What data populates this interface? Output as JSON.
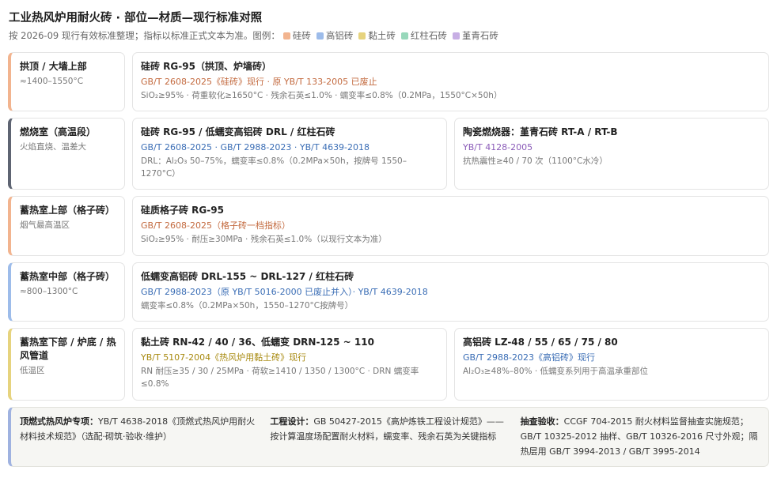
{
  "header": {
    "title": "工业热风炉用耐火砖 · 部位—材质—现行标准对照",
    "subtitle": "按 2026-09 现行有效标准整理；指标以标准正式文本为准。图例：",
    "legend": [
      {
        "label": "硅砖",
        "color": "#f2b48f"
      },
      {
        "label": "高铝砖",
        "color": "#9dbcea"
      },
      {
        "label": "黏土砖",
        "color": "#e6d37e"
      },
      {
        "label": "红柱石砖",
        "color": "#98d8bb"
      },
      {
        "label": "堇青石砖",
        "color": "#c7aee4"
      }
    ]
  },
  "rows": [
    {
      "label": {
        "title": "拱顶 / 大墙上部",
        "sub": "≈1400–1550°C",
        "accent": "#f2b48f"
      },
      "cards": [
        {
          "title": "硅砖 RG-95（拱顶、炉墙砖）",
          "std": "GB/T 2608-2025《硅砖》现行 · 原 YB/T 133-2005 已废止",
          "std_class": "silica",
          "note": "SiO₂≥95% · 荷重软化≥1650°C · 残余石英≤1.0% · 蠕变率≤0.8%（0.2MPa，1550°C×50h）"
        }
      ]
    },
    {
      "label": {
        "title": "燃烧室（高温段）",
        "sub": "火焰直烧、温差大",
        "accent": "#5e6472"
      },
      "cards": [
        {
          "title": "硅砖 RG-95 / 低蠕变高铝砖 DRL / 红柱石砖",
          "std": "GB/T 2608-2025 · GB/T 2988-2023 · YB/T 4639-2018",
          "std_class": "alumina",
          "note": "DRL：Al₂O₃ 50–75%，蠕变率≤0.8%（0.2MPa×50h，按牌号 1550–1270°C）"
        },
        {
          "title": "陶瓷燃烧器：堇青石砖 RT-A / RT-B",
          "std": "YB/T 4128-2005",
          "std_class": "cordierite",
          "note": "抗热震性≥40 / 70 次（1100°C水冷）"
        }
      ]
    },
    {
      "label": {
        "title": "蓄热室上部（格子砖）",
        "sub": "烟气最高温区",
        "accent": "#f2b48f"
      },
      "cards": [
        {
          "title": "硅质格子砖 RG-95",
          "std": "GB/T 2608-2025（格子砖一档指标）",
          "std_class": "silica",
          "note": "SiO₂≥95% · 耐压≥30MPa · 残余石英≤1.0%（以现行文本为准）"
        }
      ]
    },
    {
      "label": {
        "title": "蓄热室中部（格子砖）",
        "sub": "≈800–1300°C",
        "accent": "#9dbcea"
      },
      "cards": [
        {
          "title": "低蠕变高铝砖 DRL-155 ~ DRL-127 / 红柱石砖",
          "std": "GB/T 2988-2023（原 YB/T 5016-2000 已废止并入）· YB/T 4639-2018",
          "std_class": "alumina",
          "note": "蠕变率≤0.8%（0.2MPa×50h，1550–1270°C按牌号）"
        }
      ]
    },
    {
      "label": {
        "title": "蓄热室下部 / 炉底 / 热风管道",
        "sub": "低温区",
        "accent": "#e6d37e"
      },
      "cards": [
        {
          "title": "黏土砖 RN-42 / 40 / 36、低蠕变 DRN-125 ~ 110",
          "std": "YB/T 5107-2004《热风炉用黏土砖》现行",
          "std_class": "clay",
          "note": "RN 耐压≥35 / 30 / 25MPa · 荷软≥1410 / 1350 / 1300°C · DRN 蠕变率≤0.8%"
        },
        {
          "title": "高铝砖 LZ-48 / 55 / 65 / 75 / 80",
          "std": "GB/T 2988-2023《高铝砖》现行",
          "std_class": "alumina",
          "note": "Al₂O₃≥48%–80% · 低蠕变系列用于高温承重部位"
        }
      ]
    }
  ],
  "footer": [
    {
      "title": "顶燃式热风炉专项：",
      "text": "YB/T 4638-2018《顶燃式热风炉用耐火材料技术规范》（选配·砌筑·验收·维护）"
    },
    {
      "title": "工程设计：",
      "text": "GB 50427-2015《高炉炼铁工程设计规范》——按计算温度场配置耐火材料，蠕变率、残余石英为关键指标"
    },
    {
      "title": "抽查验收：",
      "text": "CCGF 704-2015 耐火材料监督抽查实施规范；GB/T 10325-2012 抽样、GB/T 10326-2016 尺寸外观；隔热层用 GB/T 3994-2013 / GB/T 3995-2014"
    }
  ]
}
